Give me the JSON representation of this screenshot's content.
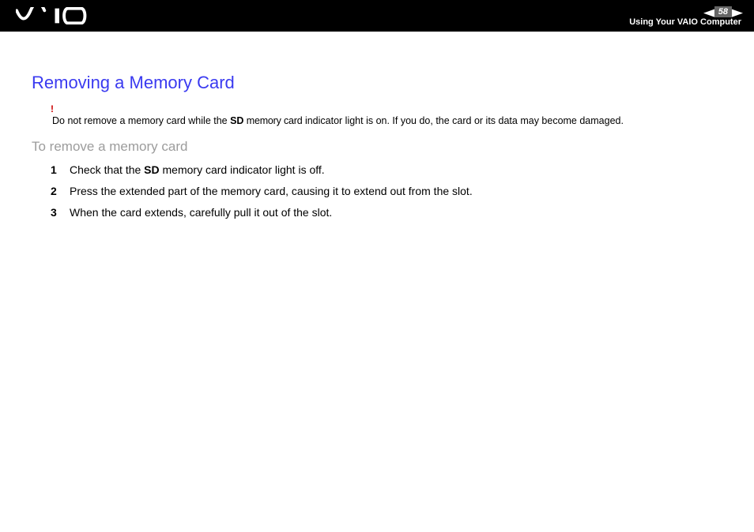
{
  "header": {
    "logo_name": "vaio-logo",
    "page_number": "58",
    "section_title": "Using Your VAIO Computer"
  },
  "doc": {
    "title": "Removing a Memory Card",
    "warning_mark": "!",
    "warning_pre": "Do not remove a memory card while the ",
    "warning_bold": "SD",
    "warning_mid": " memory card",
    "warning_post": " indicator light is on. If you do, the card or its data may become damaged.",
    "subheading": "To remove a memory card",
    "steps": [
      {
        "n": "1",
        "pre": "Check that the ",
        "bold": "SD",
        "post": " memory card indicator light is off."
      },
      {
        "n": "2",
        "pre": "Press the extended part of the memory card, causing it to extend out from the slot.",
        "bold": "",
        "post": ""
      },
      {
        "n": "3",
        "pre": "When the card extends, carefully pull it out of the slot.",
        "bold": "",
        "post": ""
      }
    ]
  }
}
